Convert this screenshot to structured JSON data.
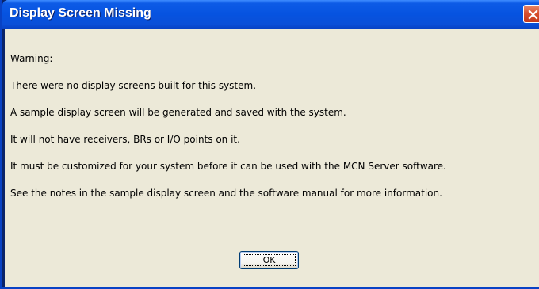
{
  "dialog": {
    "title": "Display Screen Missing",
    "messages": [
      "Warning:",
      "There were no display screens built for this system.",
      "A sample display screen will be generated and saved with the system.",
      "It will not have receivers, BRs or I/O points on it.",
      "It must be customized for your system before it can be used with the MCN Server software.",
      "See the notes in the sample display screen and the software manual for more information."
    ],
    "ok_label": "OK",
    "close_icon": "close-icon"
  },
  "colors": {
    "titlebar": "#0653e0",
    "client_bg": "#ece9d8",
    "close_button": "#d9512f"
  }
}
